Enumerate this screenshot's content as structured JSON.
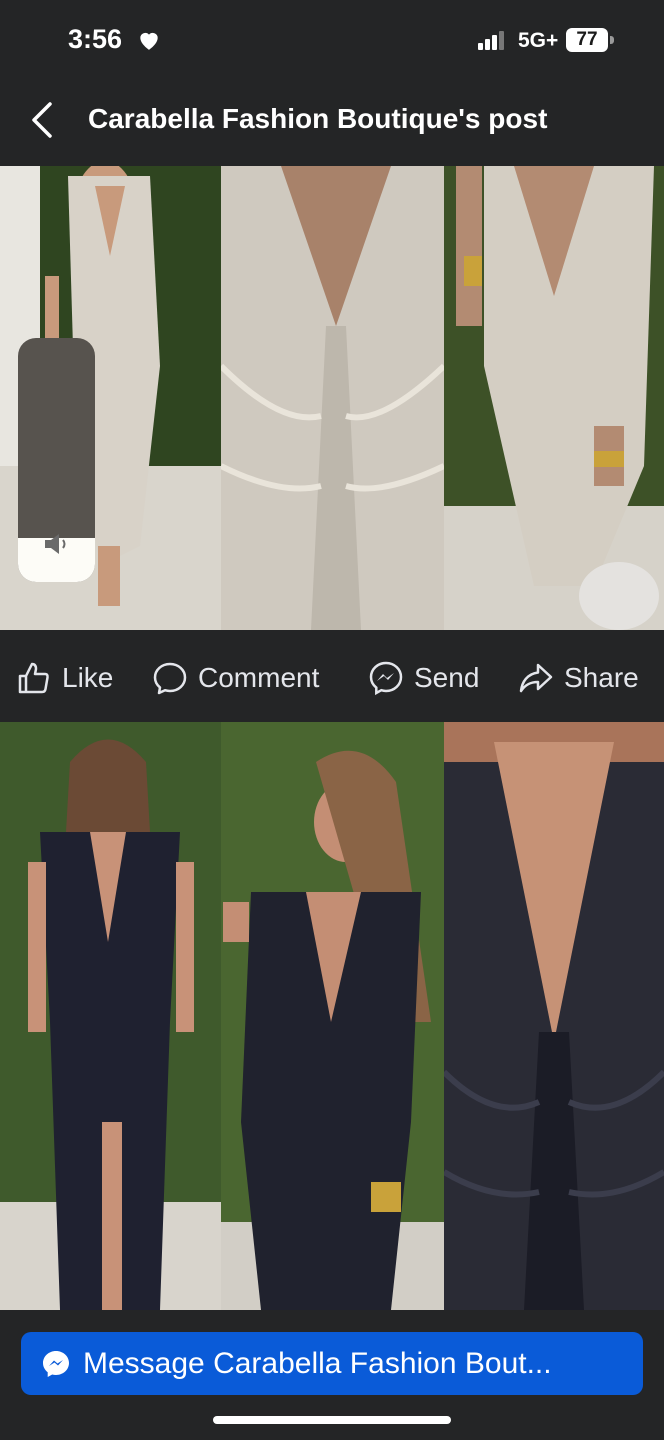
{
  "status_bar": {
    "time": "3:56",
    "network": "5G+",
    "battery": "77"
  },
  "header": {
    "title": "Carabella Fashion Boutique's post"
  },
  "volume": {
    "level": 0.18
  },
  "actions": {
    "like": "Like",
    "comment": "Comment",
    "send": "Send",
    "share": "Share"
  },
  "cta": {
    "message_label": "Message Carabella Fashion Bout..."
  },
  "colors": {
    "background": "#242526",
    "cta": "#0a5bd8",
    "silver_dress": "#d8d2c8",
    "black_dress": "#1f2130",
    "foliage": "#3f5a2c"
  },
  "icons": [
    "back-chevron-icon",
    "heart-icon",
    "signal-icon",
    "battery-icon",
    "speaker-icon",
    "thumbs-up-icon",
    "comment-bubble-icon",
    "messenger-icon",
    "share-arrow-icon"
  ]
}
